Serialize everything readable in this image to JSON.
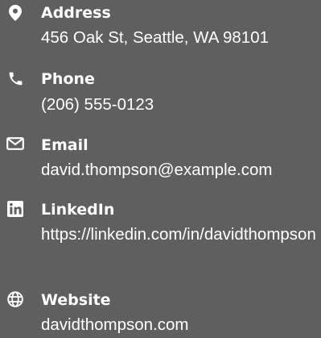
{
  "contacts": [
    {
      "icon": "map-pin-icon",
      "label": "Address",
      "value": "456 Oak St, Seattle, WA 98101"
    },
    {
      "icon": "phone-icon",
      "label": "Phone",
      "value": "(206) 555-0123"
    },
    {
      "icon": "envelope-icon",
      "label": "Email",
      "value": "david.thompson@example.com"
    },
    {
      "icon": "linkedin-icon",
      "label": "LinkedIn",
      "value": "https://linkedin.com/in/davidthompson"
    },
    {
      "icon": "globe-icon",
      "label": "Website",
      "value": "davidthompson.com"
    }
  ],
  "colors": {
    "background": "#5f5f5f",
    "text": "#ffffff"
  }
}
